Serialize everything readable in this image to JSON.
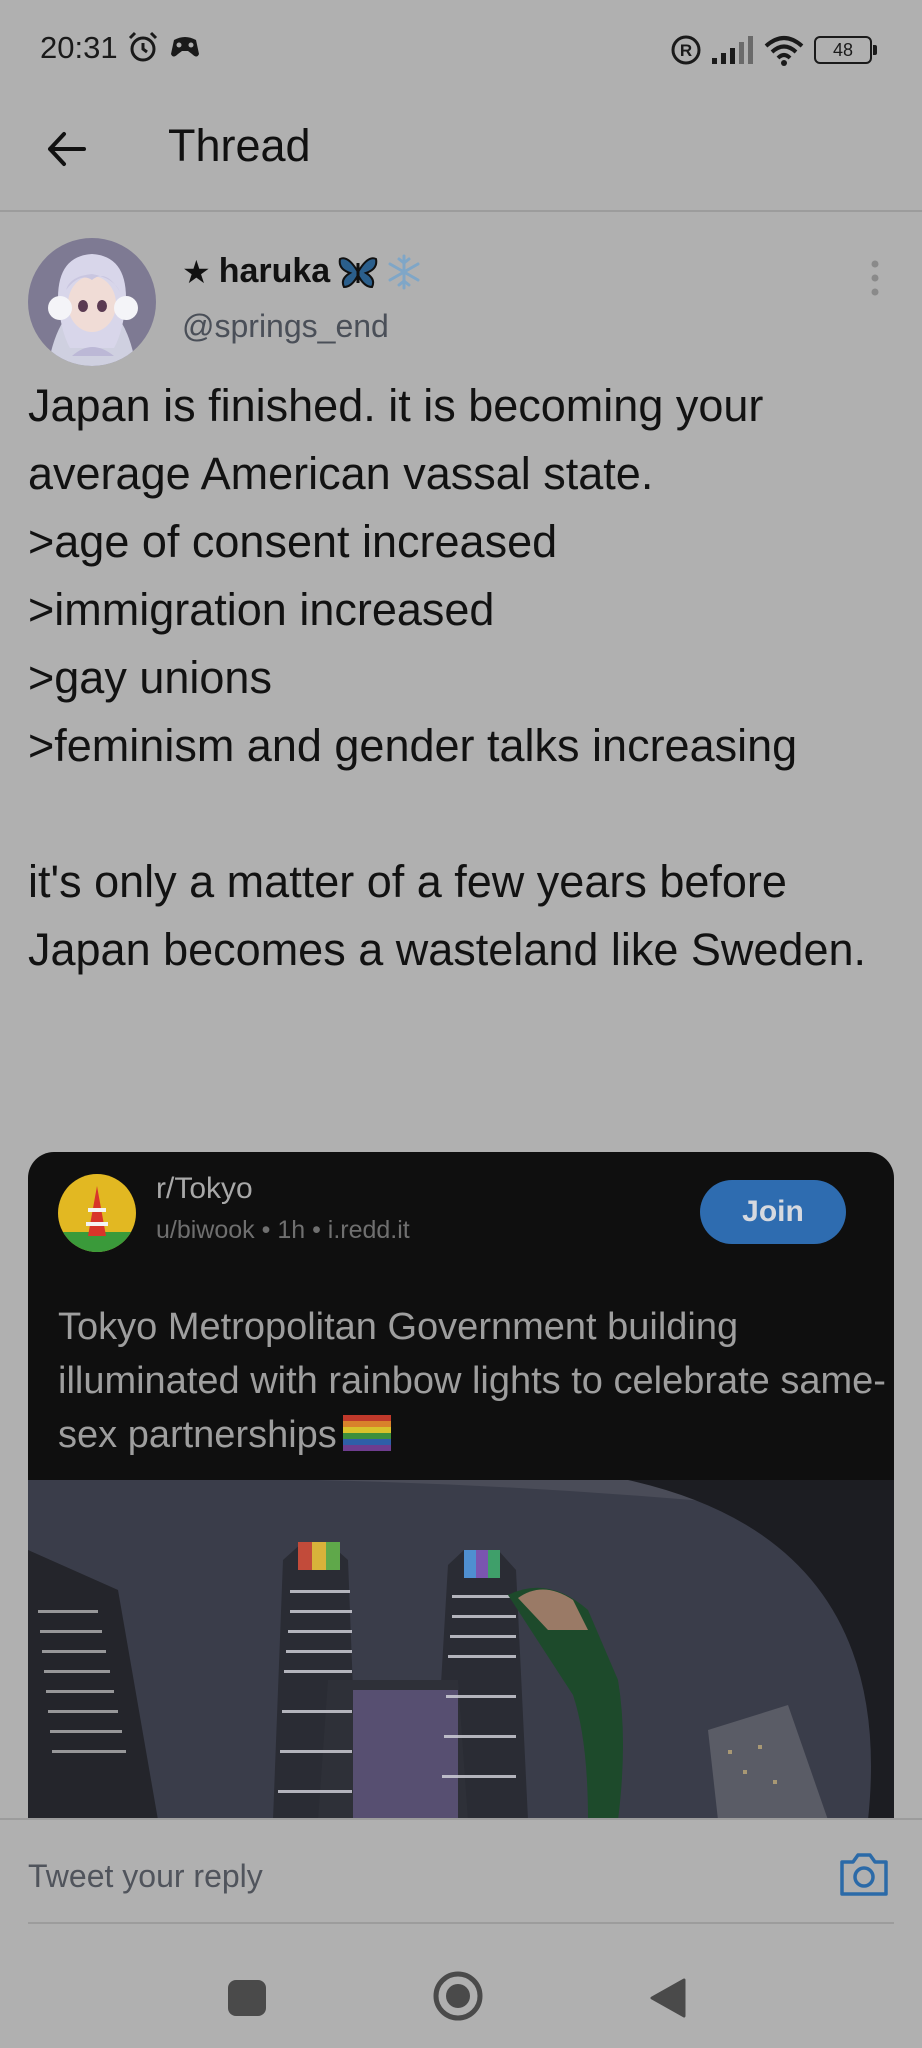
{
  "status_bar": {
    "time": "20:31",
    "battery": "48"
  },
  "header": {
    "title": "Thread"
  },
  "tweet": {
    "star": "★",
    "display_name": "haruka",
    "handle": "@springs_end",
    "body_lines": [
      "Japan is finished. it is becoming your average American vassal state.",
      ">age of consent increased",
      ">immigration increased",
      ">gay unions",
      ">feminism and gender talks increasing"
    ],
    "body_closing": "it's only a matter of a few years before Japan becomes a wasteland like Sweden."
  },
  "embed": {
    "subreddit": "r/Tokyo",
    "meta": "u/biwook • 1h • i.redd.it",
    "join_label": "Join",
    "title": "Tokyo Metropolitan Government building illuminated with rainbow lights to celebrate same-sex partnerships"
  },
  "reply": {
    "placeholder": "Tweet your reply"
  },
  "colors": {
    "background": "#b0b0b0",
    "card_background": "#0f0f0f",
    "join_button": "#2e6cb0",
    "accent_icon": "#2b6aa8"
  },
  "icons": [
    "alarm-icon",
    "game-controller-icon",
    "registered-icon",
    "signal-icon",
    "wifi-icon",
    "battery-icon",
    "back-arrow-icon",
    "butterfly-icon",
    "snowflake-icon",
    "more-vertical-icon",
    "rainbow-flag-icon",
    "camera-icon",
    "nav-recent-icon",
    "nav-home-icon",
    "nav-back-icon"
  ]
}
